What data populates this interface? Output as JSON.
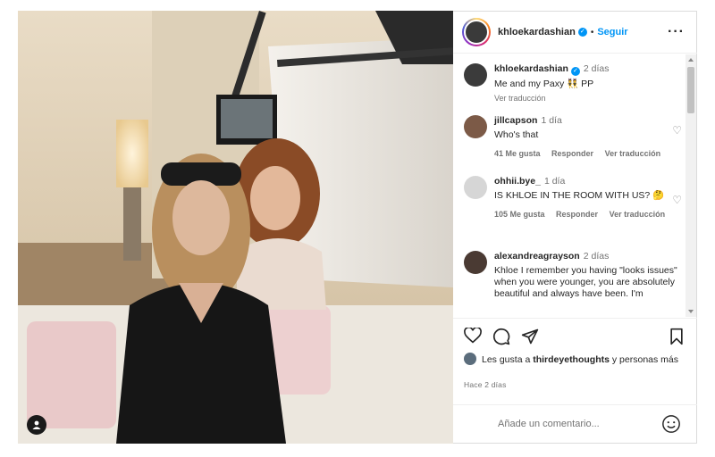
{
  "post": {
    "username": "khloekardashian",
    "follow_label": "Seguir",
    "more_label": "···"
  },
  "caption": {
    "username": "khloekardashian",
    "time": "2 días",
    "text": "Me and my Paxy 👯 PP",
    "translate": "Ver traducción"
  },
  "comments": [
    {
      "username": "jillcapson",
      "time": "1 día",
      "text": "Who's that",
      "likes": "41 Me gusta",
      "reply": "Responder",
      "translate": "Ver traducción"
    },
    {
      "username": "ohhii.bye_",
      "time": "1 día",
      "text": "IS KHLOE IN THE ROOM WITH US? 🤔",
      "likes": "105 Me gusta",
      "reply": "Responder",
      "translate": "Ver traducción"
    },
    {
      "username": "alexandreagrayson",
      "time": "2 días",
      "text": "Khloe I remember you having \"looks issues\" when you were younger, you are absolutely beautiful and always have been. I'm"
    }
  ],
  "likes": {
    "prefix": "Les gusta a ",
    "user": "thirdeyethoughts",
    "suffix": " y personas más"
  },
  "timestamp": "HACE 2 DÍAS",
  "timestamp_display": "Hace 2 días",
  "add_comment_placeholder": "Añade un comentario...",
  "icons": {
    "like": "heart-icon",
    "comment": "comment-icon",
    "share": "share-icon",
    "save": "bookmark-icon",
    "emoji": "emoji-icon",
    "tag": "user-tag-icon"
  },
  "colors": {
    "accent": "#0095f6",
    "muted": "#737373",
    "text": "#262626"
  }
}
